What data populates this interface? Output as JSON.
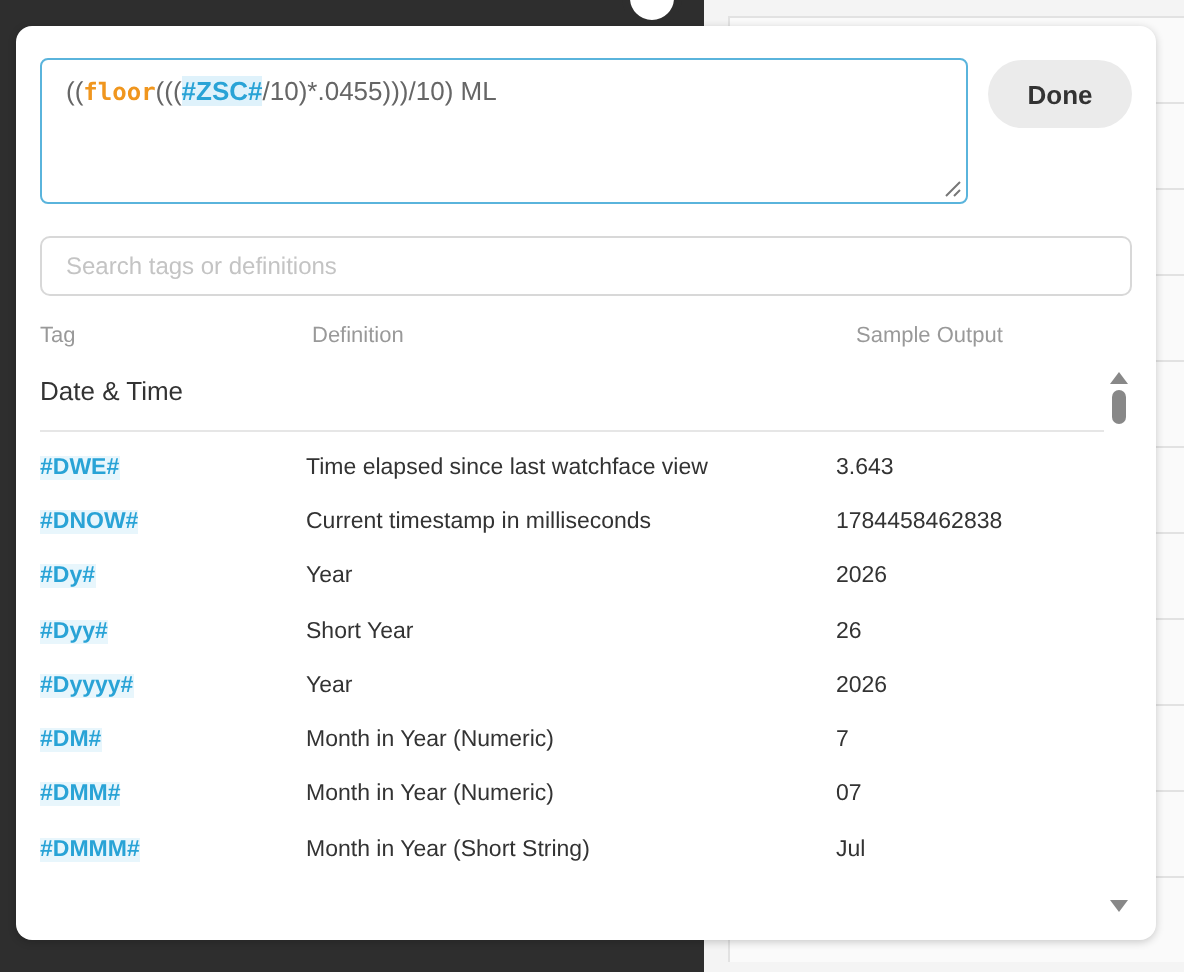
{
  "editor": {
    "segments": [
      {
        "kind": "text",
        "text": "(("
      },
      {
        "kind": "function",
        "text": "floor"
      },
      {
        "kind": "text",
        "text": "((("
      },
      {
        "kind": "tag",
        "text": "#ZSC#"
      },
      {
        "kind": "text",
        "text": "/10)*.0455)))/10) ML"
      }
    ]
  },
  "done_button": "Done",
  "search": {
    "placeholder": "Search tags or definitions"
  },
  "columns": [
    "Tag",
    "Definition",
    "Sample Output"
  ],
  "section": "Date & Time",
  "rows": [
    {
      "tag": "#DWE#",
      "definition": "Time elapsed since last watchface view",
      "sample": "3.643"
    },
    {
      "tag": "#DNOW#",
      "definition": "Current timestamp in milliseconds",
      "sample": "1784458462838"
    },
    {
      "tag": "#Dy#",
      "definition": "Year",
      "sample": "2026"
    },
    {
      "tag": "#Dyy#",
      "definition": "Short Year",
      "sample": "26"
    },
    {
      "tag": "#Dyyyy#",
      "definition": "Year",
      "sample": "2026"
    },
    {
      "tag": "#DM#",
      "definition": "Month in Year (Numeric)",
      "sample": "7"
    },
    {
      "tag": "#DMM#",
      "definition": "Month in Year (Numeric)",
      "sample": "07"
    },
    {
      "tag": "#DMMM#",
      "definition": "Month in Year (Short String)",
      "sample": "Jul"
    }
  ]
}
